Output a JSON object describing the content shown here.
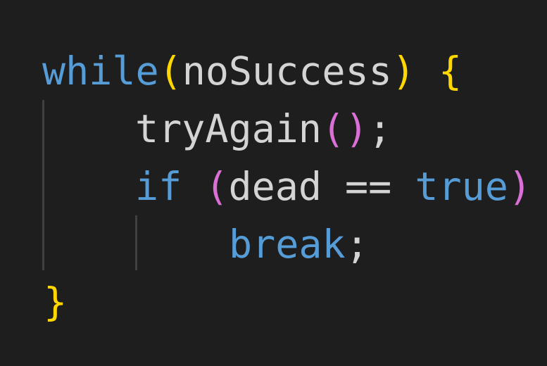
{
  "code": {
    "line1": {
      "keyword": "while",
      "open_paren": "(",
      "condition": "noSuccess",
      "close_paren": ")",
      "space": " ",
      "open_brace": "{"
    },
    "line2": {
      "call": "tryAgain",
      "open_paren": "(",
      "close_paren": ")",
      "semicolon": ";"
    },
    "line3": {
      "keyword": "if",
      "space": " ",
      "open_paren": "(",
      "expression": "dead == ",
      "literal": "true",
      "close_paren": ")"
    },
    "line4": {
      "keyword": "break",
      "semicolon": ";"
    },
    "line5": {
      "close_brace": "}"
    }
  },
  "colors": {
    "background": "#1e1e1e",
    "keyword": "#569cd6",
    "plain_text": "#d4d4d4",
    "bracket_level_1": "#ffd700",
    "bracket_level_2": "#da70d6",
    "indent_guide": "#404040"
  }
}
